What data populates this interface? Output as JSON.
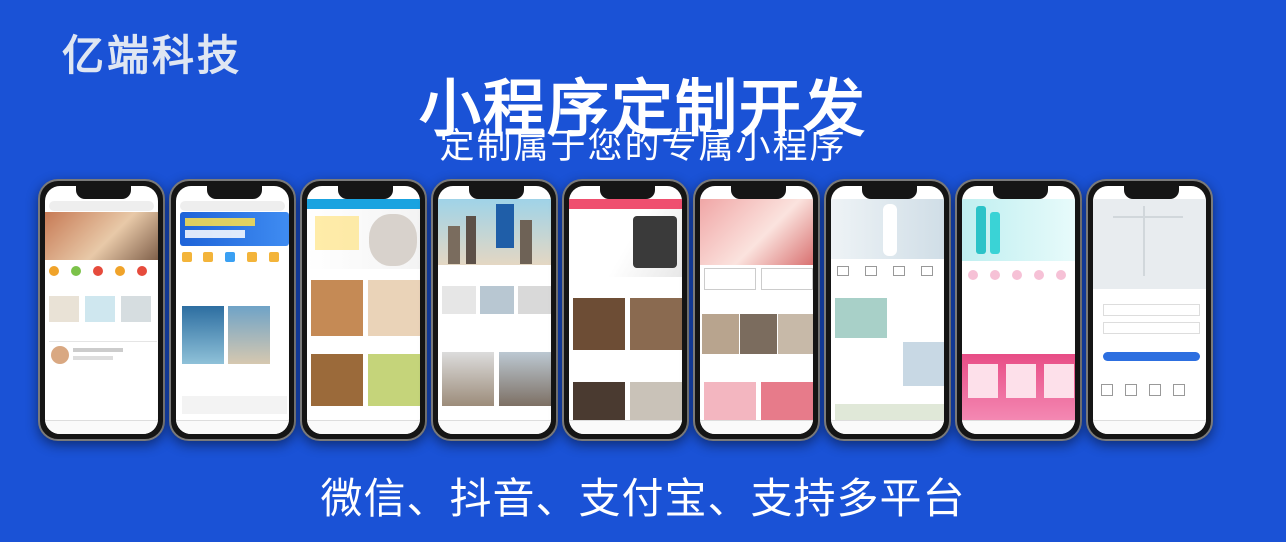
{
  "brand": "亿端科技",
  "title": "小程序定制开发",
  "subtitle": "定制属于您的专属小程序",
  "tagline": "微信、抖音、支付宝、支持多平台",
  "phones": [
    {
      "name": "furniture-service-app",
      "accent": "#e8492e"
    },
    {
      "name": "online-course-app",
      "accent": "#2a71e0"
    },
    {
      "name": "pet-store-app",
      "accent": "#f2a33a"
    },
    {
      "name": "architecture-app",
      "accent": "#e7823a"
    },
    {
      "name": "hair-salon-app",
      "accent": "#ef4f6f"
    },
    {
      "name": "flower-shop-app",
      "accent": "#d94050"
    },
    {
      "name": "wedding-photo-app",
      "accent": "#d94b4b"
    },
    {
      "name": "cosmetics-shop-app",
      "accent": "#e84d86"
    },
    {
      "name": "map-service-app",
      "accent": "#2d6fe0"
    }
  ]
}
